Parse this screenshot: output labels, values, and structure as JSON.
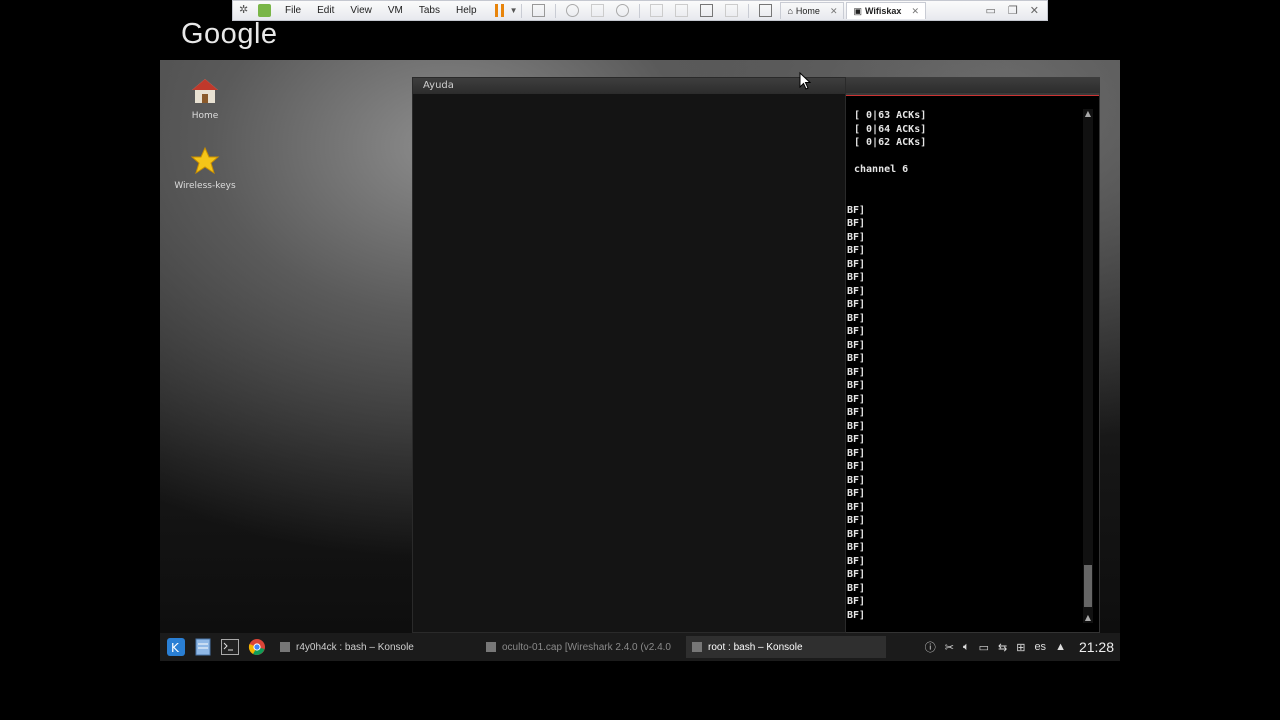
{
  "host": {
    "brand_text": "Google",
    "menus": [
      "File",
      "Edit",
      "View",
      "VM",
      "Tabs",
      "Help"
    ],
    "tabs": [
      {
        "label": "Home",
        "active": false
      },
      {
        "label": "Wifiskax",
        "active": true
      }
    ]
  },
  "desktop": {
    "icons": [
      {
        "label": "Home",
        "icon": "home-icon"
      },
      {
        "label": "Wireless-keys",
        "icon": "star-icon"
      }
    ]
  },
  "ayuda": {
    "title": "Ayuda"
  },
  "konsole": {
    "lines": [
      "[ 0|63 ACKs]",
      "[ 0|64 ACKs]",
      "[ 0|62 ACKs]",
      "",
      "channel 6",
      "",
      "",
      "BF]",
      "BF]",
      "BF]",
      "BF]",
      "BF]",
      "BF]",
      "BF]",
      "BF]",
      "BF]",
      "BF]",
      "BF]",
      "BF]",
      "BF]",
      "BF]",
      "BF]",
      "BF]",
      "BF]",
      "BF]",
      "BF]",
      "BF]",
      "BF]",
      "BF]",
      "BF]",
      "BF]",
      "BF]",
      "BF]",
      "BF]",
      "BF]",
      "BF]",
      "BF]",
      "BF]"
    ]
  },
  "taskbar": {
    "tasks": [
      {
        "label": "r4y0h4ck : bash – Konsole",
        "state": "normal"
      },
      {
        "label": "oculto-01.cap [Wireshark 2.4.0 (v2.4.0",
        "state": "dim"
      },
      {
        "label": "root : bash – Konsole",
        "state": "active"
      }
    ],
    "keyboard_layout": "es",
    "clock": "21:28"
  }
}
